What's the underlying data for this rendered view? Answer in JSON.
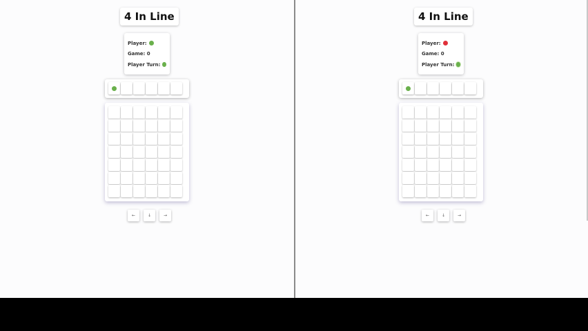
{
  "title": "4 In Line",
  "colors": {
    "green": "#6ab04c",
    "red": "#e0303a",
    "background": "#fcfcfd"
  },
  "left": {
    "player_label": "Player:",
    "player_color": "green",
    "game_label": "Game: 0",
    "turn_label": "Player Turn:",
    "turn_color": "green",
    "selector_disc_column": 1,
    "controls": [
      "←",
      "↓",
      "→"
    ]
  },
  "right": {
    "player_label": "Player:",
    "player_color": "red",
    "game_label": "Game: 0",
    "turn_label": "Player Turn:",
    "turn_color": "green",
    "selector_disc_column": 1,
    "controls": [
      "←",
      "↓",
      "→"
    ]
  },
  "board": {
    "columns": 6,
    "rows": 7
  }
}
